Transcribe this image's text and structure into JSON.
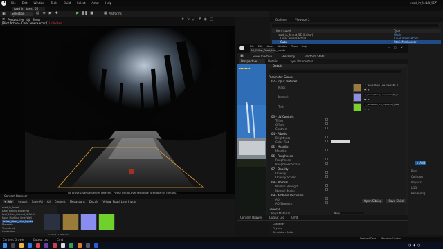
{
  "app": {
    "project": "road_in_forest_5E"
  },
  "menu": [
    "File",
    "Edit",
    "Window",
    "Tools",
    "Build",
    "Select",
    "Actor",
    "Help"
  ],
  "top_tab": "road_in_forest_5E",
  "toolbar": {
    "mode": "Selection Mode",
    "platforms": "Platforms"
  },
  "viewport": {
    "perspective": "Perspective",
    "lit": "Lit",
    "show": "Show",
    "pilot_prefix": "[Pilot Active - CineCameraActor1]",
    "pilot_flag": "Unlocked",
    "message": "No active Level Sequencer detected. Please edit a Level Sequence to enable full controls."
  },
  "outliner": {
    "tabs": [
      "Outliner",
      "Viewport 2"
    ],
    "header_label": "Item Label",
    "header_type": "Type",
    "items": [
      {
        "label": "road_in_forest_5E (Editor)",
        "type": "World"
      },
      {
        "label": "CineCameraActor1",
        "type": "CineCameraActor"
      },
      {
        "label": "Cube",
        "type": "StaticMeshActor"
      }
    ]
  },
  "material_editor": {
    "menu": [
      "File",
      "Edit",
      "Asset",
      "Window",
      "Tools",
      "Help"
    ],
    "tab": "MI_Yellow_Road_Line_Inputs",
    "tools": [
      "Show Inactive",
      "Hierarchy",
      "Platform Stats"
    ],
    "subtabs": [
      "Perspective",
      "Details",
      "Layer Parameters"
    ],
    "details_title": "Details",
    "sections": {
      "parameter_groups": "Parameter Groups",
      "texture_group": "02 - Input Textures",
      "uv_group": "03 - UV Controls",
      "albedo_group": "04 - Albedo",
      "metallic_group": "05 - Metallic",
      "roughness_group": "06 - Roughness",
      "opacity_group": "07 - Opacity",
      "normal_group": "08 - Normal",
      "ao_group": "09 - Ambient Occlusion",
      "general": "General"
    },
    "textures": [
      {
        "label": "Mask",
        "name": "T_Yellow_Road_Line_mask_4K_D",
        "color": "#9c7a3c"
      },
      {
        "label": "Normal",
        "name": "T_Yellow_Road_Line_mask_4K_N",
        "color": "#8f8fe6"
      },
      {
        "label": "Tint",
        "name": "T_WhitePixel_Un_Inputs_4K_ORM",
        "color": "#79d12a"
      }
    ],
    "rows": [
      "Tiling",
      "Offset",
      "Contrast",
      "Brightness",
      "Color Tint",
      "Metallic",
      "Roughness",
      "Roughness Scalar",
      "Opacity",
      "Opacity Scalar",
      "Normal Strength",
      "Normal Scalar",
      "AO",
      "AO Strength"
    ],
    "general_row": "Phys Material",
    "general_value": "None",
    "buttons": [
      "Open Sibling",
      "Save Child"
    ],
    "bottom": [
      "Content Drawer",
      "Output Log",
      "Cmd"
    ]
  },
  "content_browser": {
    "tab": "Content Browser",
    "add": "+ Add",
    "import": "Import",
    "save_all": "Save All",
    "path": [
      "All",
      "Content",
      "Megascans",
      "Decals",
      "Yellow_Road_Line_Inputs"
    ],
    "tree": [
      "road_in_forest",
      "Bark_Planks_subdirect",
      "Leaf_Litter_Ground_4Mphlt",
      "Road_Marking_Line_Wall",
      "Yellow_Road_Line_Inputs",
      "Materials",
      "Thumbnail",
      "Collections"
    ],
    "selected_index": 4,
    "summary": "4 items (1 selected)",
    "thumbs": [
      "#2a3140",
      "#9b7b3a",
      "#8a8df0",
      "#6fd12b"
    ]
  },
  "lower_right": [
    "Character",
    "Physics",
    "Simulation Guide"
  ],
  "right_panel": {
    "add": "+ Add",
    "rows": [
      "Root",
      "Collision",
      "Physics",
      "LOD",
      "Rendering"
    ]
  },
  "status": {
    "items": [
      "Content Drawer",
      "Output Log",
      "Cmd"
    ],
    "right": [
      "Derived Data",
      "Revision Control"
    ]
  }
}
